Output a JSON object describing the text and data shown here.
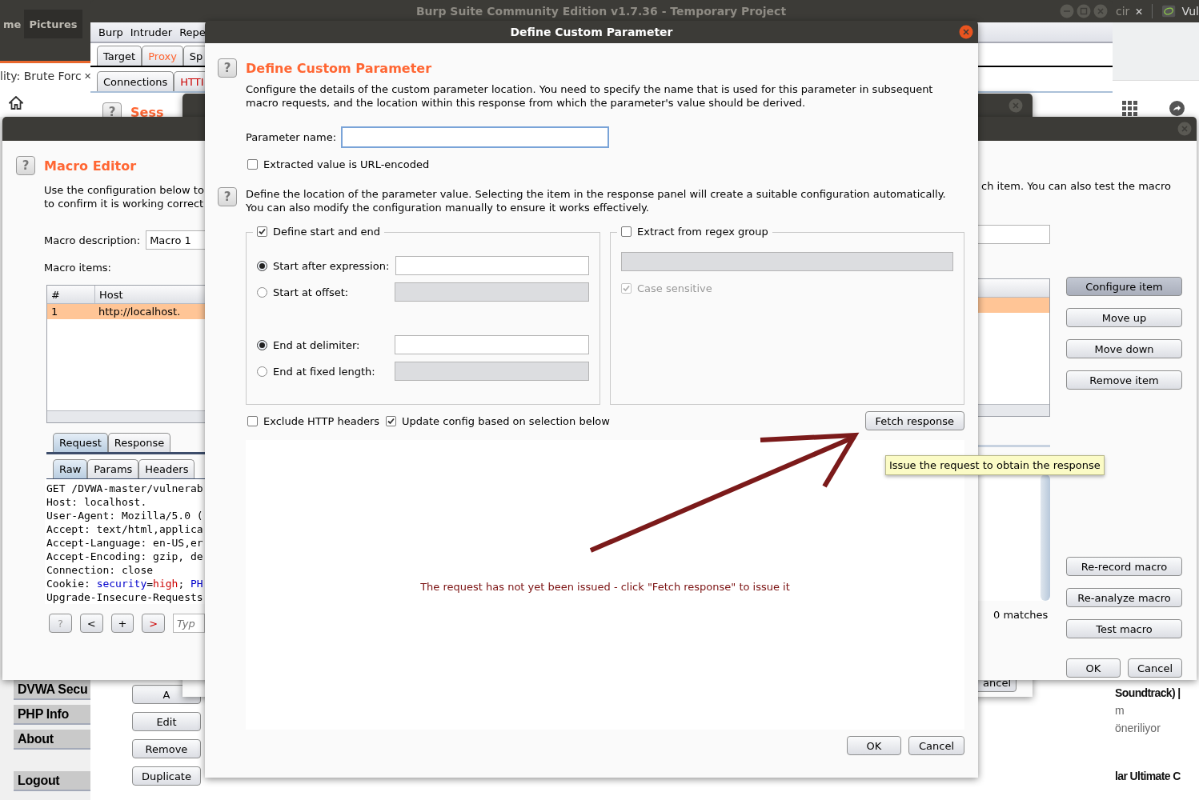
{
  "desktop": {
    "title": "Burp Suite Community Edition v1.7.36 - Temporary Project",
    "left_tabs": [
      "me",
      "Pictures"
    ],
    "right_tabs": [
      "cir",
      "Vul"
    ]
  },
  "browser": {
    "tab_title": "lity: Brute Forc",
    "menu": [
      "DVWA Secu",
      "PHP Info",
      "About",
      "Logout"
    ],
    "page_texts": [
      {
        "text": "Soundtrack) |",
        "kind": "title"
      },
      {
        "text": "m",
        "kind": "meta"
      },
      {
        "text": "öneriliyor",
        "kind": "meta"
      },
      {
        "text": "lar Ultimate C",
        "kind": "title"
      }
    ]
  },
  "burp": {
    "menu": [
      "Burp",
      "Intruder",
      "Repe"
    ],
    "tabs": [
      {
        "label": "Target",
        "color": "#000000"
      },
      {
        "label": "Proxy",
        "color": "#ff6633"
      },
      {
        "label": "Sp",
        "color": "#000000"
      }
    ],
    "subtabs": [
      {
        "label": "Connections",
        "color": "#000000"
      },
      {
        "label": "HTTI",
        "color": "#cc0000"
      }
    ],
    "help": "?",
    "section_title": "Sess",
    "session_buttons": [
      "A",
      "Edit",
      "Remove",
      "Duplicate"
    ],
    "dialog_button": "ancel"
  },
  "macro_editor": {
    "help": "?",
    "title": "Macro Editor",
    "intro_left": [
      "Use the configuration below to",
      "to confirm it is working correct"
    ],
    "intro_right": "ch item. You can also test the macro",
    "description_label": "Macro description:",
    "description_value": "Macro 1",
    "items_label": "Macro items:",
    "columns": [
      "#",
      "Host"
    ],
    "rows": [
      {
        "cells": [
          "1",
          "http://localhost."
        ],
        "selected": true
      }
    ],
    "tabs": [
      {
        "label": "Request",
        "selected": true
      },
      {
        "label": "Response",
        "selected": false
      }
    ],
    "subtabs": [
      {
        "label": "Raw",
        "selected": true
      },
      {
        "label": "Params",
        "selected": false
      },
      {
        "label": "Headers",
        "selected": false
      }
    ],
    "request_lines": [
      {
        "parts": [
          {
            "text": "GET /DVWA-master/vulnerab",
            "kind": "plain"
          }
        ]
      },
      {
        "parts": [
          {
            "text": "Host: localhost.",
            "kind": "plain"
          }
        ]
      },
      {
        "parts": [
          {
            "text": "User-Agent: Mozilla/5.0 (",
            "kind": "plain"
          }
        ]
      },
      {
        "parts": [
          {
            "text": "Accept: text/html,applica",
            "kind": "plain"
          }
        ]
      },
      {
        "parts": [
          {
            "text": "Accept-Language: en-US,er",
            "kind": "plain"
          }
        ]
      },
      {
        "parts": [
          {
            "text": "Accept-Encoding: gzip, de",
            "kind": "plain"
          }
        ]
      },
      {
        "parts": [
          {
            "text": "Connection: close",
            "kind": "plain"
          }
        ]
      },
      {
        "parts": [
          {
            "text": "Cookie: ",
            "kind": "plain"
          },
          {
            "text": "security",
            "kind": "name"
          },
          {
            "text": "=",
            "kind": "plain"
          },
          {
            "text": "high",
            "kind": "value"
          },
          {
            "text": "; ",
            "kind": "plain"
          },
          {
            "text": "PH",
            "kind": "name"
          }
        ]
      },
      {
        "parts": [
          {
            "text": "Upgrade-Insecure-Requests",
            "kind": "plain"
          }
        ]
      }
    ],
    "nav_buttons": [
      "?",
      "<",
      "+",
      ">"
    ],
    "search_placeholder": "Typ",
    "matches": "0 matches",
    "item_buttons": [
      {
        "label": "Configure item",
        "selected": true
      },
      {
        "label": "Move up",
        "selected": false
      },
      {
        "label": "Move down",
        "selected": false
      },
      {
        "label": "Remove item",
        "selected": false
      }
    ],
    "macro_buttons": [
      "Re-record macro",
      "Re-analyze macro",
      "Test macro"
    ],
    "ok": "OK",
    "cancel": "Cancel"
  },
  "dialog": {
    "window_title": "Define Custom Parameter",
    "help": "?",
    "heading": "Define Custom Parameter",
    "intro": "Configure the details of the custom parameter location. You need to specify the name that is used for this parameter in subsequent macro requests, and the location within this response from which the parameter's value should be derived.",
    "parameter_label": "Parameter name:",
    "url_encoded": {
      "label": "Extracted value is URL-encoded",
      "checked": false
    },
    "location_help": "Define the location of the parameter value. Selecting the item in the response panel will create a suitable configuration automatically. You can also modify the configuration manually to ensure it works effectively.",
    "start_end": {
      "label": "Define start and end",
      "checked": true,
      "options": [
        {
          "label": "Start after expression:",
          "selected": true,
          "disabled": false
        },
        {
          "label": "Start at offset:",
          "selected": false,
          "disabled": true
        },
        {
          "label": "End at delimiter:",
          "selected": true,
          "disabled": false
        },
        {
          "label": "End at fixed length:",
          "selected": false,
          "disabled": true
        }
      ]
    },
    "regex": {
      "label": "Extract from regex group",
      "checked": false,
      "case_sensitive": {
        "label": "Case sensitive",
        "checked": true,
        "disabled": true
      }
    },
    "exclude_headers": {
      "label": "Exclude HTTP headers",
      "checked": false
    },
    "update_config": {
      "label": "Update config based on selection below",
      "checked": true
    },
    "fetch_button": "Fetch response",
    "tooltip": "Issue the request to obtain the response",
    "response_message": "The request has not yet been issued - click \"Fetch response\" to issue it",
    "ok": "OK",
    "cancel": "Cancel"
  }
}
